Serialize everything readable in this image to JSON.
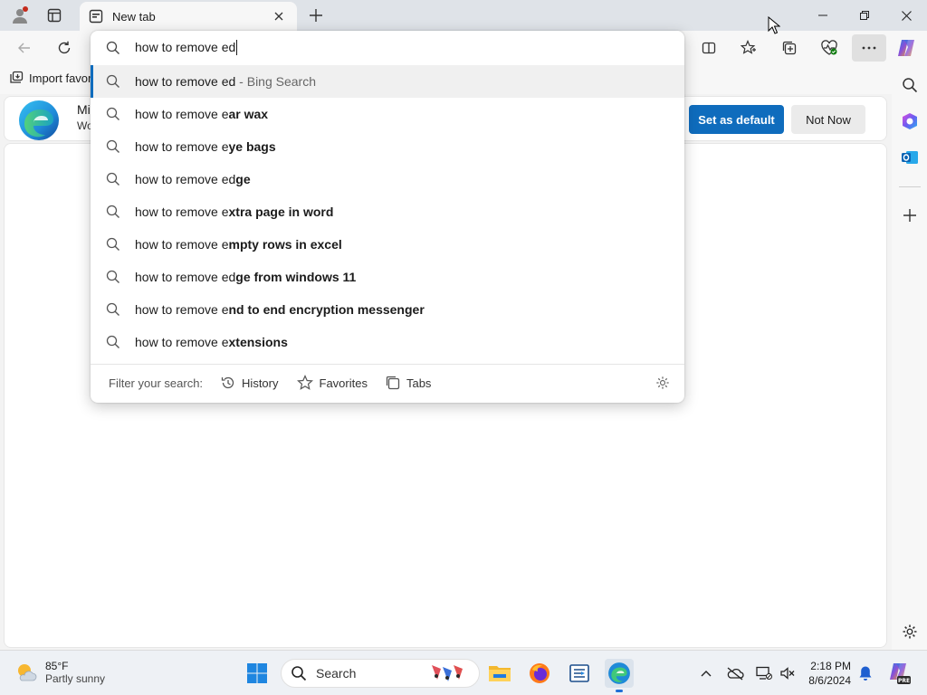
{
  "window": {
    "tab_title": "New tab",
    "colors": {
      "accent": "#0f6cbd",
      "tab_bar": "#dfe3e8"
    }
  },
  "favorites_bar": {
    "import_label": "Import favor"
  },
  "banner": {
    "title_partial": "Mi",
    "subtitle_partial": "Wo",
    "set_default_label": "Set as default",
    "not_now_label": "Not Now"
  },
  "address": {
    "typed_text": "how to remove ed"
  },
  "suggestions": [
    {
      "typed": "how to remove ed",
      "completion": "",
      "hint": " - Bing Search",
      "selected": true
    },
    {
      "typed": "how to remove e",
      "completion": "ar wax",
      "hint": "",
      "selected": false
    },
    {
      "typed": "how to remove e",
      "completion": "ye bags",
      "hint": "",
      "selected": false
    },
    {
      "typed": "how to remove ed",
      "completion": "ge",
      "hint": "",
      "selected": false
    },
    {
      "typed": "how to remove e",
      "completion": "xtra page in word",
      "hint": "",
      "selected": false
    },
    {
      "typed": "how to remove e",
      "completion": "mpty rows in excel",
      "hint": "",
      "selected": false
    },
    {
      "typed": "how to remove ed",
      "completion": "ge from windows 11",
      "hint": "",
      "selected": false
    },
    {
      "typed": "how to remove e",
      "completion": "nd to end encryption messenger",
      "hint": "",
      "selected": false
    },
    {
      "typed": "how to remove e",
      "completion": "xtensions",
      "hint": "",
      "selected": false
    }
  ],
  "filter": {
    "label": "Filter your search:",
    "history": "History",
    "favorites": "Favorites",
    "tabs": "Tabs"
  },
  "taskbar": {
    "weather_temp": "85°F",
    "weather_desc": "Partly sunny",
    "search_label": "Search",
    "time": "2:18 PM",
    "date": "8/6/2024"
  },
  "icons": {
    "profile": "profile-icon",
    "workspaces": "workspaces-icon",
    "tab_favicon": "newtab-page-icon",
    "close": "close-icon",
    "new_tab": "plus-icon",
    "back": "back-arrow-icon",
    "refresh": "refresh-icon",
    "split_screen": "split-screen-icon",
    "favorites": "favorites-star-icon",
    "collections": "collections-icon",
    "browser_essentials": "heart-pulse-icon",
    "more": "more-dots-icon",
    "copilot": "copilot-icon",
    "search": "search-icon",
    "gear": "gear-icon"
  }
}
